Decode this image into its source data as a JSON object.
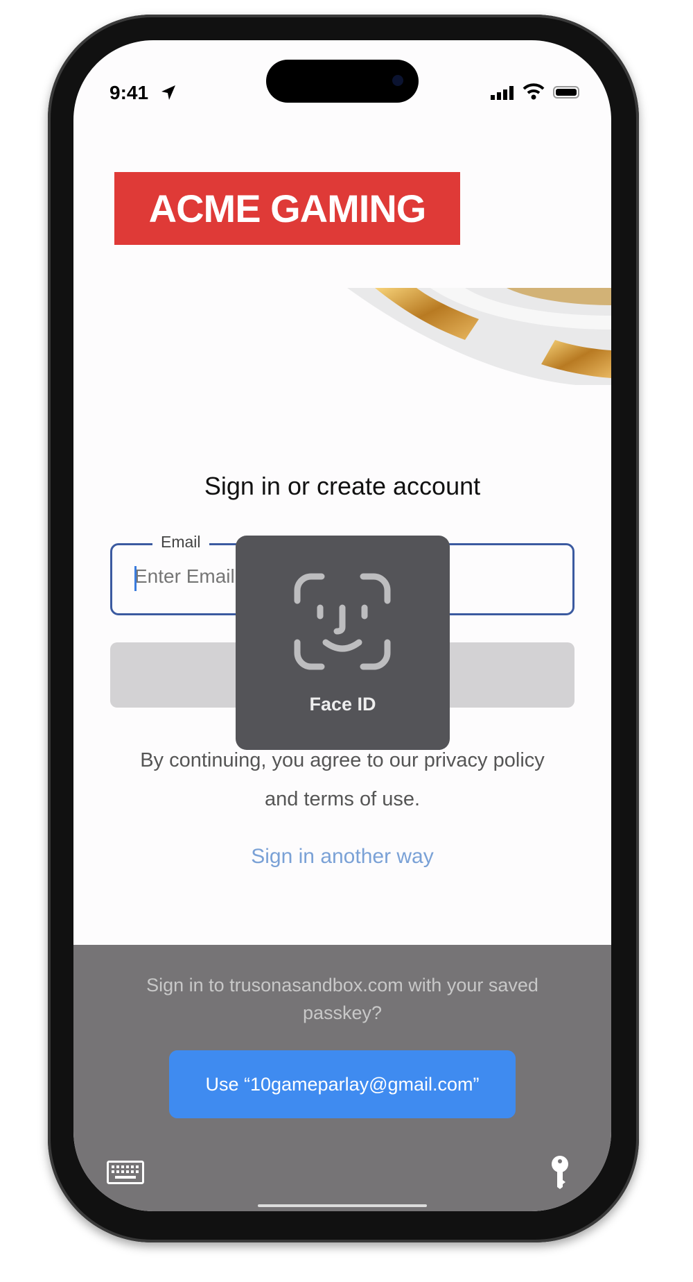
{
  "status_bar": {
    "time": "9:41",
    "icons": [
      "location-arrow-icon",
      "cellular-signal-icon",
      "wifi-icon",
      "battery-icon"
    ]
  },
  "brand": {
    "logo_text": "ACME GAMING",
    "color": "#df3a37"
  },
  "page": {
    "title": "Sign in or create account",
    "email_label": "Email",
    "email_placeholder": "Enter Email",
    "email_value": "",
    "terms_line1": "By continuing, you agree to our privacy policy",
    "terms_line2": "and terms of use.",
    "alt_signin": "Sign in another way"
  },
  "face_id": {
    "label": "Face ID",
    "icon": "face-id-icon"
  },
  "passkey_sheet": {
    "prompt": "Sign in to trusonasandbox.com with your saved passkey?",
    "use_button": "Use “10gameparlay@gmail.com”",
    "button_color": "#3f8bf0",
    "icons": [
      "keyboard-icon",
      "key-icon"
    ]
  }
}
